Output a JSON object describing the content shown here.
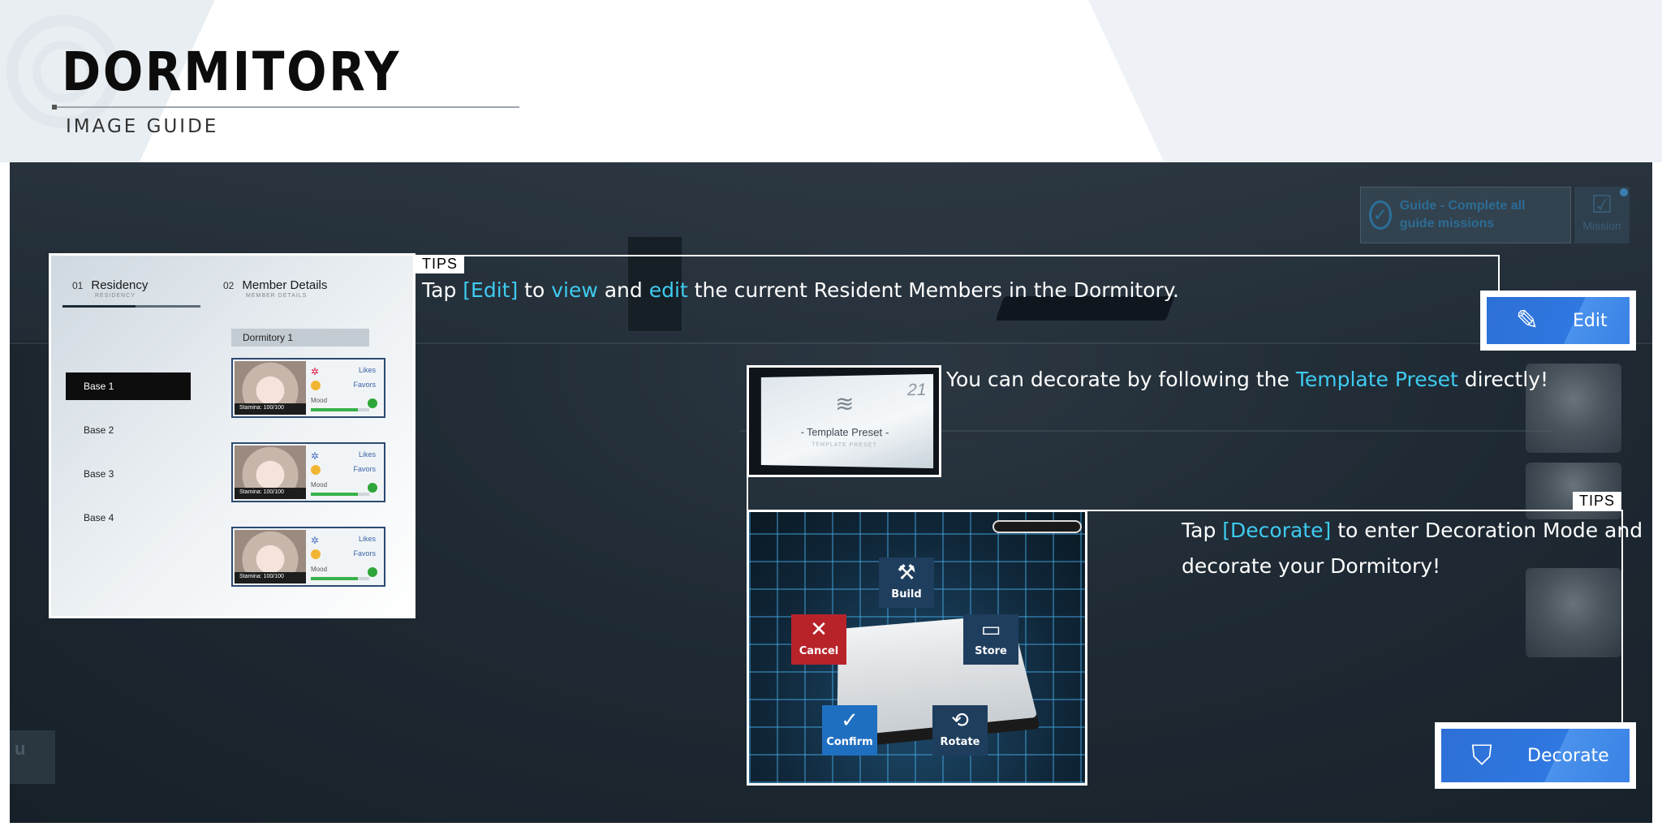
{
  "header": {
    "title": "DORMITORY",
    "subtitle": "IMAGE GUIDE"
  },
  "scene": {
    "mission_text": "Guide - Complete all guide missions",
    "mission_button": "Mission",
    "left_button": "u"
  },
  "residency_panel": {
    "tab1_num": "01",
    "tab1_label": "Residency",
    "tab1_sub": "RESIDENCY",
    "tab2_num": "02",
    "tab2_label": "Member Details",
    "tab2_sub": "MEMBER DETAILS",
    "bases": [
      "Base 1",
      "Base 2",
      "Base 3",
      "Base 4"
    ],
    "active_base": "Base 1",
    "dormitory_label": "Dormitory 1",
    "members": [
      {
        "stamina": "Stamina: 100/100",
        "likes": "Likes",
        "favors": "Favors",
        "mood": "Mood",
        "mood_level": 0.8
      },
      {
        "stamina": "Stamina: 100/100",
        "likes": "Likes",
        "favors": "Favors",
        "mood": "Mood",
        "mood_level": 0.8
      },
      {
        "stamina": "Stamina: 100/100",
        "likes": "Likes",
        "favors": "Favors",
        "mood": "Mood",
        "mood_level": 0.8
      }
    ]
  },
  "tips": {
    "label": "TIPS",
    "edit_tip": {
      "p1": "Tap ",
      "h1": "[Edit]",
      "p2": " to ",
      "h2": "view",
      "p3": " and ",
      "h3": "edit",
      "p4": " the current Resident Members in the Dormitory."
    },
    "preset_tip": {
      "p1": "You can decorate by following the ",
      "h1": "Template Preset",
      "p2": " directly!"
    },
    "decorate_tip": {
      "p1": "Tap ",
      "h1": "[Decorate]",
      "p2": " to enter Decoration Mode and",
      "p3": "decorate your Dormitory!"
    }
  },
  "buttons": {
    "edit": "Edit",
    "decorate": "Decorate"
  },
  "preset_card": {
    "number": "21",
    "name": "- Template Preset -",
    "sub": "TEMPLATE PRESET"
  },
  "decoration_ops": {
    "build": "Build",
    "cancel": "Cancel",
    "store": "Store",
    "confirm": "Confirm",
    "rotate": "Rotate"
  },
  "colors": {
    "highlight": "#3ecbf0",
    "button_blue": "#2f78e0",
    "cancel_red": "#b8232a"
  },
  "icons": {
    "edit": "edit-pencil-icon",
    "decorate": "plant-pot-icon",
    "build": "tools-icon",
    "cancel": "close-icon",
    "store": "box-icon",
    "confirm": "check-icon",
    "rotate": "rotate-icon",
    "preset": "layers-icon"
  }
}
